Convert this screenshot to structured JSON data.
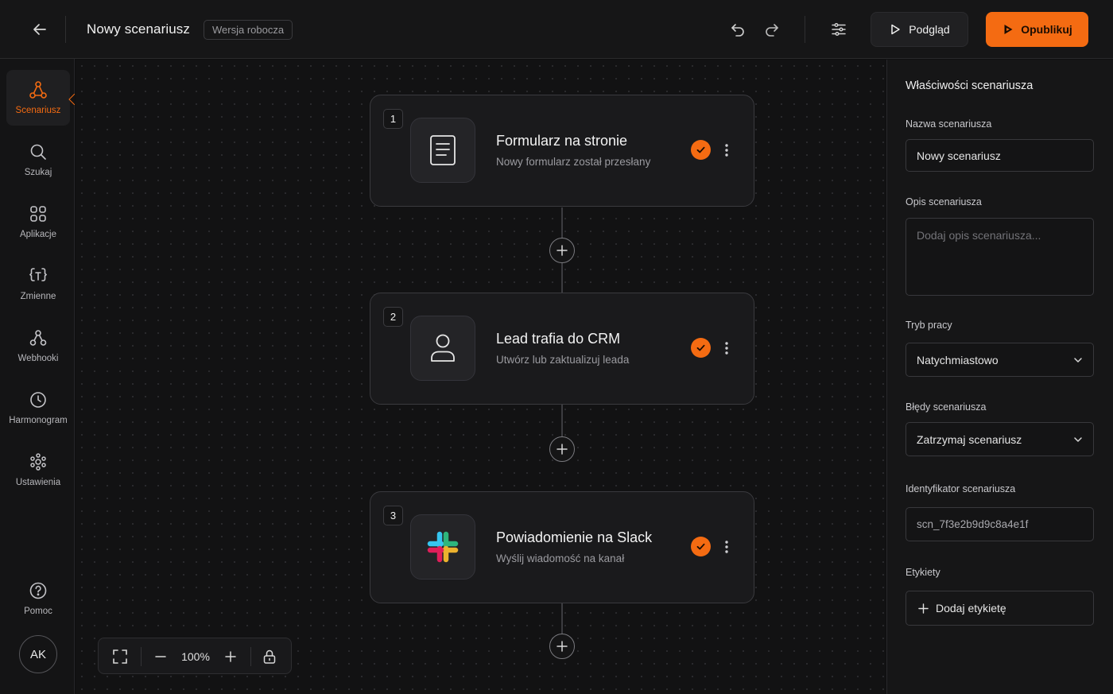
{
  "header": {
    "title": "Nowy scenariusz",
    "status_badge": "Wersja robocza",
    "preview_label": "Podgląd",
    "publish_label": "Opublikuj",
    "accent_color": "#f46b12"
  },
  "sidebar": {
    "items": [
      {
        "label": "Scenariusz",
        "icon": "scenario-icon",
        "active": true
      },
      {
        "label": "Szukaj",
        "icon": "search-icon"
      },
      {
        "label": "Aplikacje",
        "icon": "apps-icon"
      },
      {
        "label": "Zmienne",
        "icon": "variables-icon"
      },
      {
        "label": "Webhooki",
        "icon": "webhook-icon"
      },
      {
        "label": "Harmonogram",
        "icon": "clock-icon"
      },
      {
        "label": "Ustawienia",
        "icon": "gear-icon"
      }
    ],
    "help_label": "Pomoc",
    "avatar_initials": "AK"
  },
  "steps": [
    {
      "number": "1",
      "title": "Formularz na stronie",
      "subtitle": "Nowy formularz został przesłany",
      "icon": "form-icon"
    },
    {
      "number": "2",
      "title": "Lead trafia do CRM",
      "subtitle": "Utwórz lub zaktualizuj leada",
      "icon": "user-icon"
    },
    {
      "number": "3",
      "title": "Powiadomienie na Slack",
      "subtitle": "Wyślij wiadomość na kanał",
      "icon": "slack-icon"
    }
  ],
  "zoom": {
    "level": "100%"
  },
  "panel": {
    "title": "Właściwości scenariusza",
    "name_label": "Nazwa scenariusza",
    "name_value": "Nowy scenariusz",
    "description_label": "Opis scenariusza",
    "description_placeholder": "Dodaj opis scenariusza...",
    "mode_label": "Tryb pracy",
    "mode_value": "Natychmiastowo",
    "errors_label": "Błędy scenariusza",
    "errors_value": "Zatrzymaj scenariusz",
    "id_label": "Identyfikator scenariusza",
    "id_value": "scn_7f3e2b9d9c8a4e1f",
    "tags_label": "Etykiety",
    "add_tag_label": "Dodaj etykietę"
  }
}
